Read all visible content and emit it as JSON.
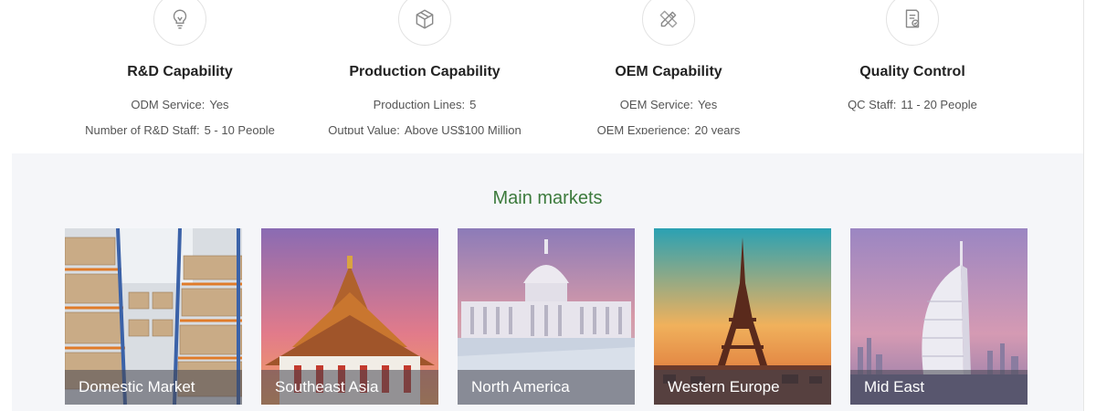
{
  "capabilities": [
    {
      "title": "R&D Capability",
      "icon": "lightbulb-icon",
      "lines": [
        {
          "k": "ODM Service",
          "v": "Yes"
        },
        {
          "k": "Number of R&D Staff",
          "v": "5 - 10 People"
        }
      ]
    },
    {
      "title": "Production Capability",
      "icon": "box-icon",
      "lines": [
        {
          "k": "Production Lines",
          "v": "5"
        },
        {
          "k": "Output Value",
          "v": "Above US$100 Million"
        }
      ]
    },
    {
      "title": "OEM Capability",
      "icon": "pencil-ruler-icon",
      "lines": [
        {
          "k": "OEM Service",
          "v": "Yes"
        },
        {
          "k": "OEM Experience",
          "v": "20 years"
        }
      ]
    },
    {
      "title": "Quality Control",
      "icon": "checklist-icon",
      "lines": [
        {
          "k": "QC Staff",
          "v": "11 - 20 People"
        }
      ]
    }
  ],
  "markets": {
    "title": "Main markets",
    "items": [
      {
        "label": "Domestic Market"
      },
      {
        "label": "Southeast Asia"
      },
      {
        "label": "North America"
      },
      {
        "label": "Western Europe"
      },
      {
        "label": "Mid East"
      }
    ]
  },
  "colors": {
    "accent_green": "#3c7a3c",
    "panel_bg": "#f5f6f9"
  }
}
